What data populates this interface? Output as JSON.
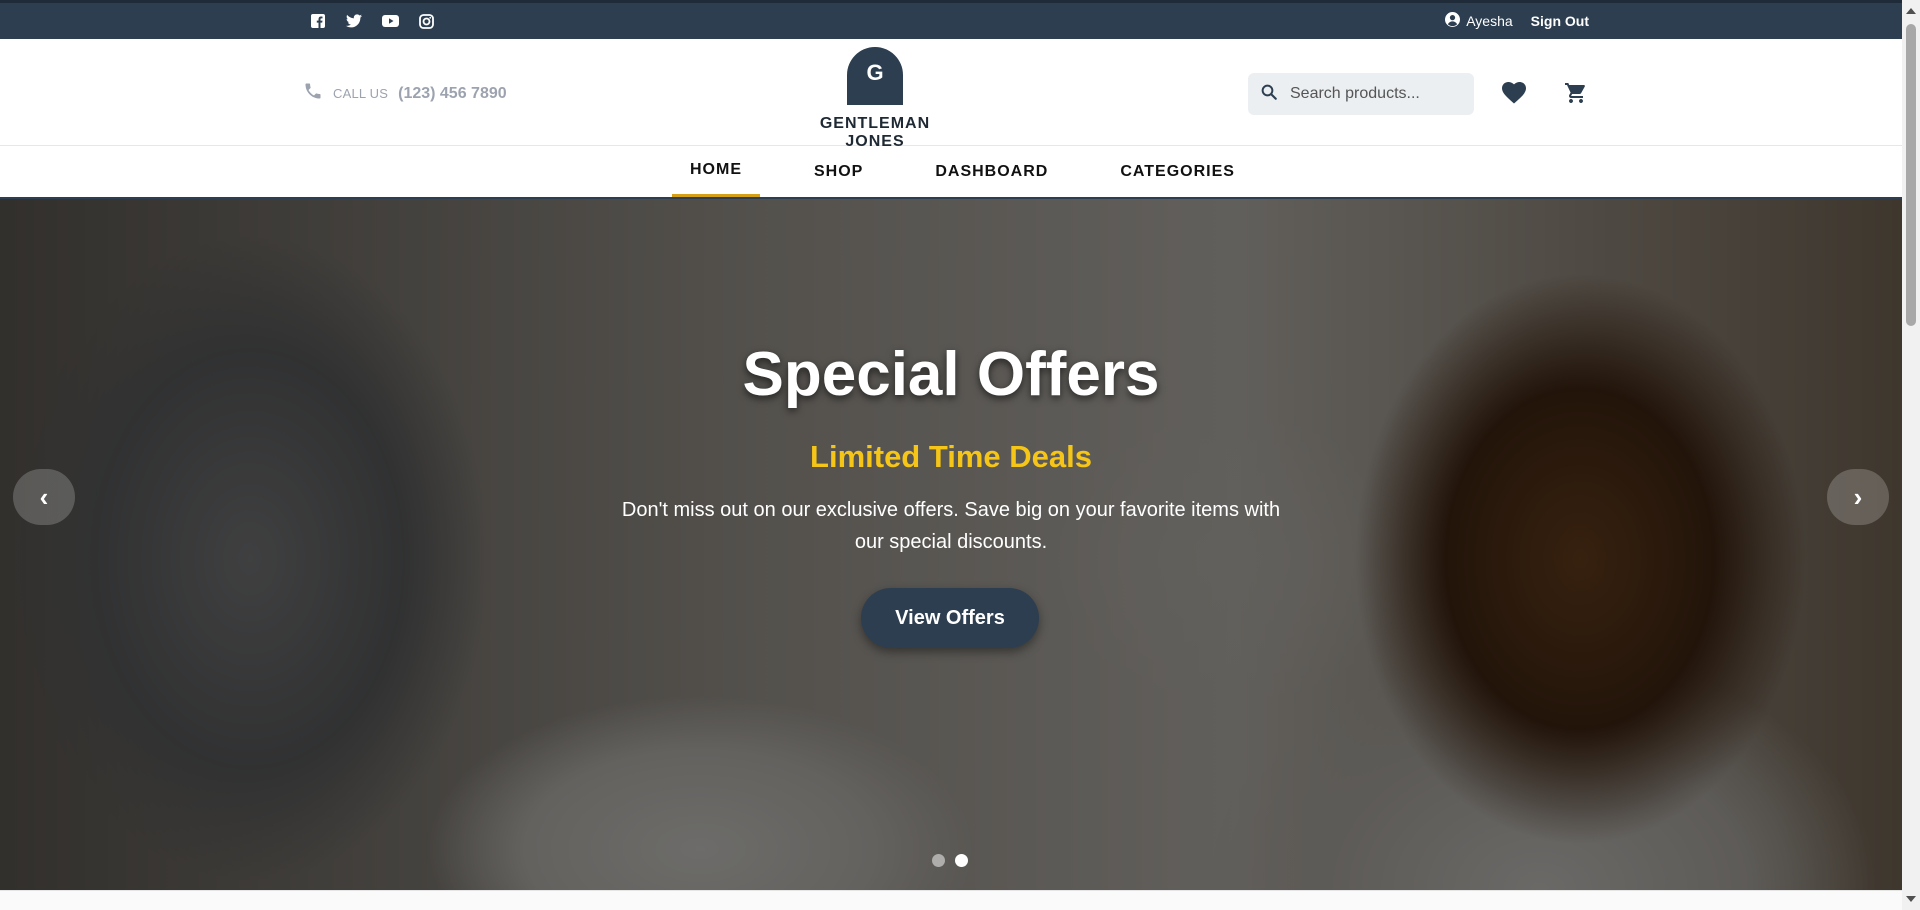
{
  "topbar": {
    "social_icons": [
      "facebook-icon",
      "twitter-icon",
      "youtube-icon",
      "instagram-icon"
    ],
    "user_name": "Ayesha",
    "sign_out_label": "Sign Out"
  },
  "header": {
    "call_label": "CALL US",
    "phone": "(123) 456 7890",
    "logo_letter": "G",
    "brand_name": "GENTLEMAN JONES",
    "search_placeholder": "Search products...",
    "icons": [
      "heart-icon",
      "cart-icon"
    ]
  },
  "nav": {
    "items": [
      {
        "label": "HOME",
        "active": true
      },
      {
        "label": "SHOP",
        "active": false
      },
      {
        "label": "DASHBOARD",
        "active": false
      },
      {
        "label": "CATEGORIES",
        "active": false
      }
    ]
  },
  "hero": {
    "title": "Special Offers",
    "subtitle": "Limited Time Deals",
    "description": "Don't miss out on our exclusive offers. Save big on your favorite items with our special discounts.",
    "cta_label": "View Offers",
    "prev_symbol": "‹",
    "next_symbol": "›",
    "slide_count": 2,
    "active_slide": 2
  },
  "colors": {
    "primary": "#2c3e50",
    "accent_yellow": "#f5c518",
    "nav_underline": "#d4a017"
  }
}
